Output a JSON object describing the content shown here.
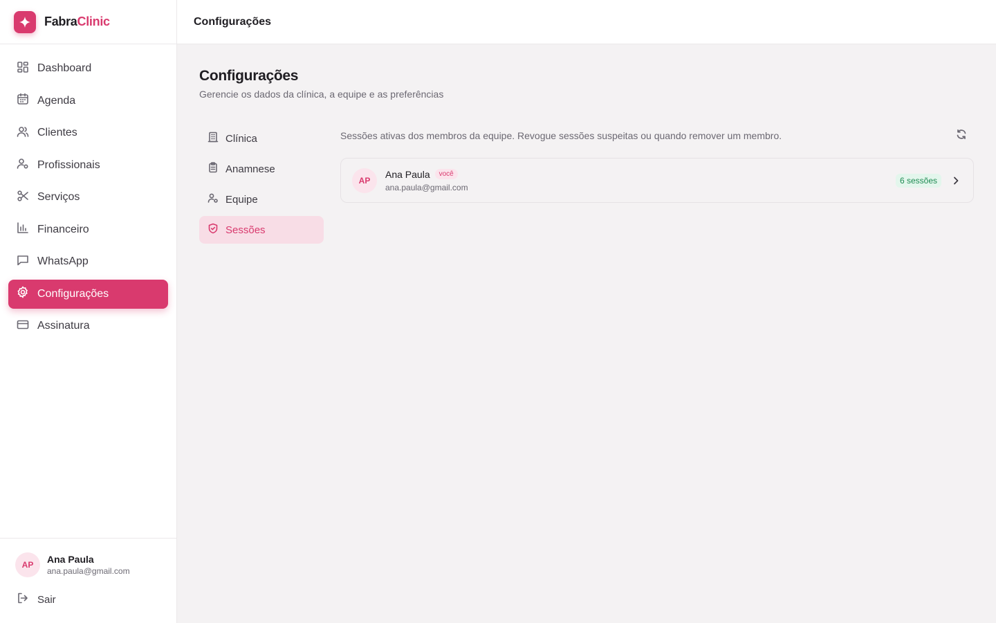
{
  "brand": {
    "name_part1": "Fabra",
    "name_part2": "Clinic",
    "accent_color": "#d93a6e"
  },
  "sidebar": {
    "items": [
      {
        "label": "Dashboard",
        "icon": "dashboard-icon",
        "active": false
      },
      {
        "label": "Agenda",
        "icon": "calendar-icon",
        "active": false
      },
      {
        "label": "Clientes",
        "icon": "users-icon",
        "active": false
      },
      {
        "label": "Profissionais",
        "icon": "user-cog-icon",
        "active": false
      },
      {
        "label": "Serviços",
        "icon": "scissors-icon",
        "active": false
      },
      {
        "label": "Financeiro",
        "icon": "bar-chart-icon",
        "active": false
      },
      {
        "label": "WhatsApp",
        "icon": "message-icon",
        "active": false
      },
      {
        "label": "Configurações",
        "icon": "gear-icon",
        "active": true
      },
      {
        "label": "Assinatura",
        "icon": "credit-card-icon",
        "active": false
      }
    ],
    "user": {
      "initials": "AP",
      "name": "Ana Paula",
      "email": "ana.paula@gmail.com"
    },
    "logout_label": "Sair"
  },
  "topbar": {
    "title": "Configurações"
  },
  "main": {
    "title": "Configurações",
    "subtitle": "Gerencie os dados da clínica, a equipe e as preferências"
  },
  "subnav": {
    "items": [
      {
        "label": "Clínica",
        "icon": "building-icon",
        "active": false
      },
      {
        "label": "Anamnese",
        "icon": "clipboard-icon",
        "active": false
      },
      {
        "label": "Equipe",
        "icon": "user-cog-icon",
        "active": false
      },
      {
        "label": "Sessões",
        "icon": "shield-icon",
        "active": true
      }
    ]
  },
  "sessions": {
    "description": "Sessões ativas dos membros da equipe. Revogue sessões suspeitas ou quando remover um membro.",
    "members": [
      {
        "initials": "AP",
        "name": "Ana Paula",
        "badge": "você",
        "email": "ana.paula@gmail.com",
        "sessions_label": "6 sessões"
      }
    ]
  }
}
